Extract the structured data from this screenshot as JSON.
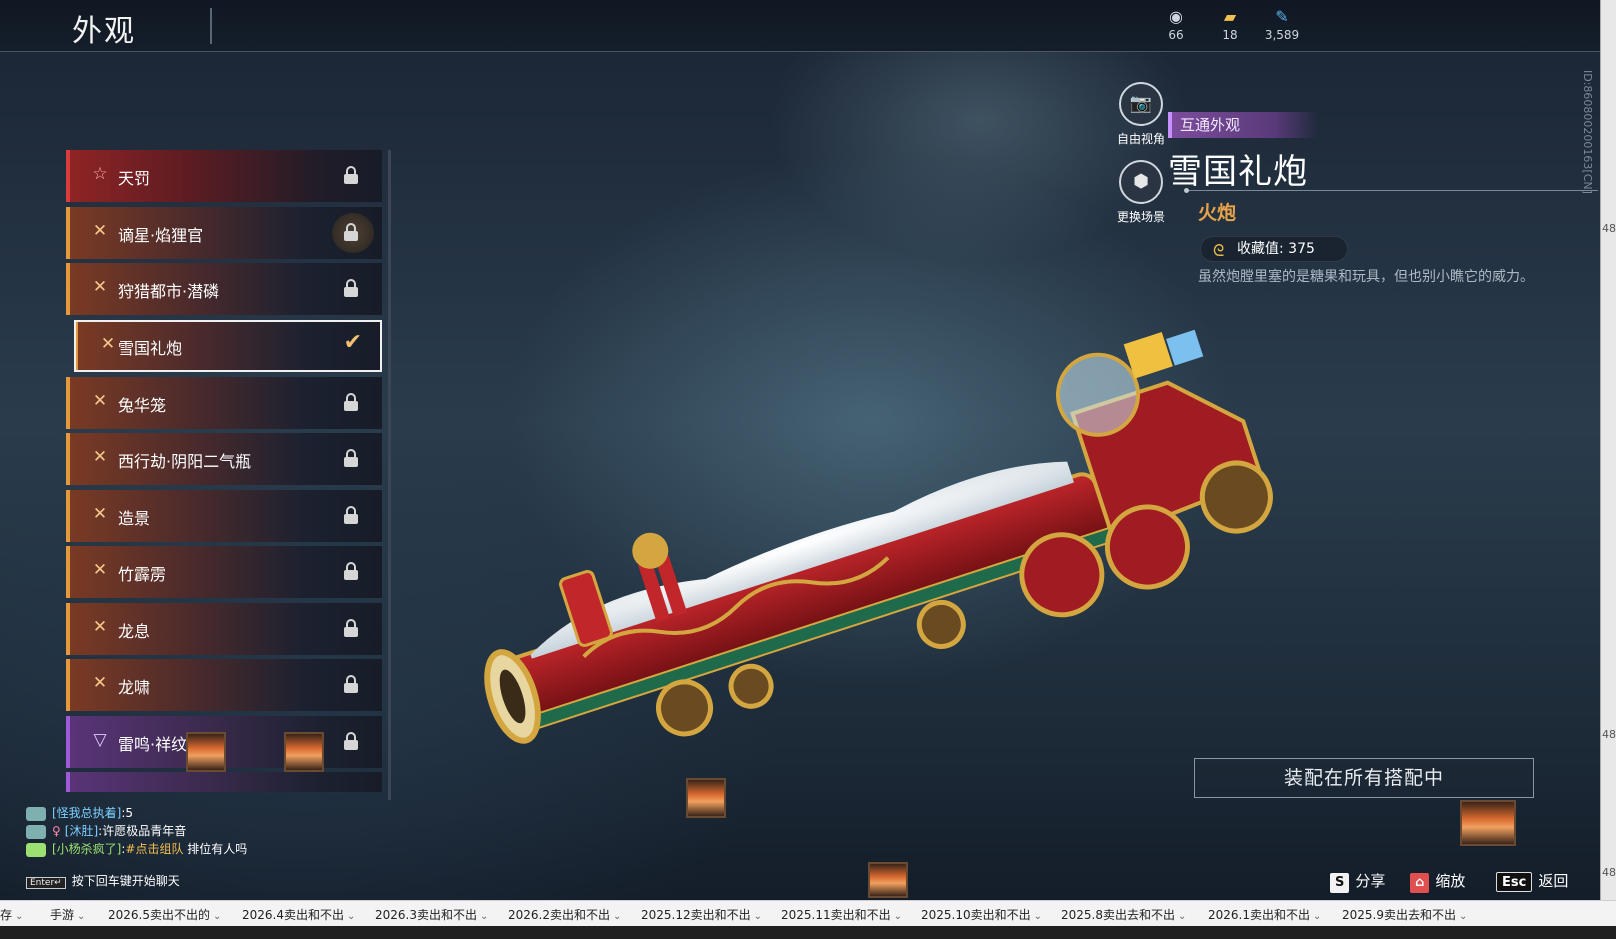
{
  "header": {
    "title": "外观",
    "currencies": [
      {
        "icon": "eye-currency-icon",
        "value": "66"
      },
      {
        "icon": "ticket-currency-icon",
        "value": "18"
      },
      {
        "icon": "feather-currency-icon",
        "value": "3,589"
      }
    ]
  },
  "id_text": "ID:860800200163[CN]",
  "skins": [
    {
      "label": "天罚",
      "icon": "star-outline-icon",
      "state": "locked",
      "rarity": "red"
    },
    {
      "label": "谪星·焰狸官",
      "icon": "rarity-cross-icon",
      "state": "locked",
      "rarity": "orange"
    },
    {
      "label": "狩猎都市·潜磷",
      "icon": "rarity-cross-icon",
      "state": "locked",
      "rarity": "orange"
    },
    {
      "label": "雪国礼炮",
      "icon": "rarity-cross-icon",
      "state": "selected",
      "rarity": "orange"
    },
    {
      "label": "兔华笼",
      "icon": "rarity-cross-icon",
      "state": "locked",
      "rarity": "orange"
    },
    {
      "label": "西行劫·阴阳二气瓶",
      "icon": "rarity-cross-icon",
      "state": "locked",
      "rarity": "orange"
    },
    {
      "label": "造景",
      "icon": "rarity-cross-icon",
      "state": "locked",
      "rarity": "orange"
    },
    {
      "label": "竹霹雳",
      "icon": "rarity-cross-icon",
      "state": "locked",
      "rarity": "orange"
    },
    {
      "label": "龙息",
      "icon": "rarity-cross-icon",
      "state": "locked",
      "rarity": "orange"
    },
    {
      "label": "龙啸",
      "icon": "rarity-cross-icon",
      "state": "locked",
      "rarity": "orange"
    },
    {
      "label": "雷鸣·祥纹",
      "icon": "rarity-triangle-icon",
      "state": "locked",
      "rarity": "purple"
    }
  ],
  "view_buttons": {
    "free_view": "自由视角",
    "change_scene": "更换场景"
  },
  "detail": {
    "tag": "互通外观",
    "name": "雪国礼炮",
    "type": "火炮",
    "collection_label": "收藏值: 375",
    "description": "虽然炮膛里塞的是糖果和玩具，但也别小瞧它的威力。",
    "equip_button": "装配在所有搭配中"
  },
  "hints": [
    {
      "key": "S",
      "label": "分享"
    },
    {
      "key": "⌂",
      "label": "缩放"
    },
    {
      "key": "Esc",
      "label": "返回"
    }
  ],
  "chat": {
    "lines": [
      {
        "name": "[怪我总执着]",
        "text": ":5"
      },
      {
        "name": "[沐肚]",
        "text": ":许愿极品青年音"
      },
      {
        "name": "[小杨杀疯了]",
        "text": ":",
        "highlight": "#点击组队",
        "tail": " 排位有人吗"
      }
    ],
    "enter_key": "Enter↵",
    "hint": "按下回车键开始聊天"
  },
  "bookmarks": [
    "存",
    "手游",
    "2026.5卖出不出的",
    "2026.4卖出和不出",
    "2026.3卖出和不出",
    "2026.2卖出和不出",
    "2025.12卖出和不出",
    "2025.11卖出和不出",
    "2025.10卖出和不出",
    "2025.8卖出去和不出",
    "2026.1卖出和不出",
    "2025.9卖出去和不出"
  ],
  "right_edge_numbers": [
    "48",
    "48",
    "48"
  ]
}
